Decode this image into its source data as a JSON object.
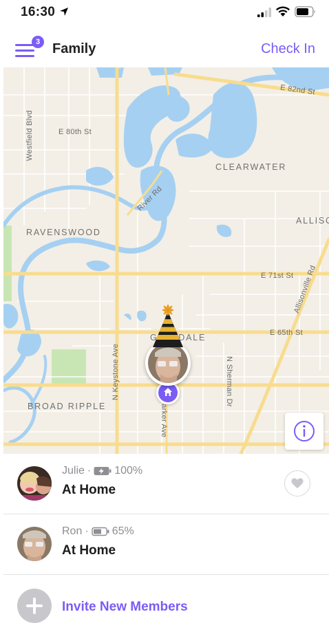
{
  "status_bar": {
    "time": "16:30",
    "icons": [
      "location-arrow-icon",
      "signal-icon",
      "wifi-icon",
      "battery-icon"
    ]
  },
  "header": {
    "menu_badge": "3",
    "title": "Family",
    "check_in": "Check In"
  },
  "map": {
    "streets": {
      "e82nd": "E 82nd St",
      "e80th": "E 80th St",
      "westfield": "Westfield Blvd",
      "river_rd": "River Rd",
      "e71st": "E 71st St",
      "e65th": "E 65th St",
      "allisonville": "Allisonville Rd",
      "keystone": "N Keystone Ave",
      "parker": "N Parker Ave",
      "sherman": "N Sherman Dr"
    },
    "areas": {
      "clearwater": "CLEARWATER",
      "ravenswood": "RAVENSWOOD",
      "allisc": "ALLISC",
      "glendale": "GLENDALE",
      "broad_ripple": "BROAD RIPPLE"
    },
    "colors": {
      "water": "#a6d0f2",
      "land": "#f3efe6",
      "road_major": "#f8dc8e",
      "park": "#c8e6b4",
      "accent": "#7b5cf5"
    }
  },
  "members": [
    {
      "name": "Julie",
      "separator": "·",
      "battery": "100%",
      "charging": true,
      "status": "At Home",
      "show_heart": true
    },
    {
      "name": "Ron",
      "separator": "·",
      "battery": "65%",
      "charging": false,
      "status": "At Home",
      "show_heart": false
    }
  ],
  "invite": {
    "label": "Invite New Members"
  }
}
